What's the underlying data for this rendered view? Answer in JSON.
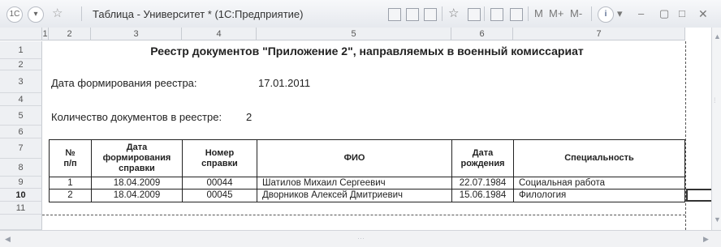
{
  "window": {
    "title": "Таблица - Университет * (1С:Предприятие)",
    "app_icon": "1С",
    "toolbar": {
      "m_label": "M",
      "m_plus_label": "M+",
      "m_minus_label": "M-",
      "info_label": "i"
    }
  },
  "columns": [
    "1",
    "2",
    "3",
    "4",
    "5",
    "6",
    "7"
  ],
  "rows": [
    "1",
    "2",
    "3",
    "4",
    "5",
    "6",
    "7",
    "8",
    "9",
    "10",
    "11"
  ],
  "active_row": "10",
  "sheet": {
    "title": "Реестр документов \"Приложение 2\", направляемых в военный комиссариат",
    "date_label": "Дата формирования реестра:",
    "date_value": "17.01.2011",
    "count_label": "Количество документов в реестре:",
    "count_value": "2",
    "table": {
      "headers": {
        "num": "№\nп/п",
        "date": "Дата\nформирования\nсправки",
        "cert": "Номер\nсправки",
        "fio": "ФИО",
        "birth": "Дата\nрождения",
        "spec": "Специальность"
      },
      "rows": [
        {
          "num": "1",
          "date": "18.04.2009",
          "cert": "00044",
          "fio": "Шатилов  Михаил Сергеевич",
          "birth": "22.07.1984",
          "spec": "Социальная работа"
        },
        {
          "num": "2",
          "date": "18.04.2009",
          "cert": "00045",
          "fio": "Дворников Алексей Дмитриевич",
          "birth": "15.06.1984",
          "spec": "Филология"
        }
      ]
    }
  }
}
